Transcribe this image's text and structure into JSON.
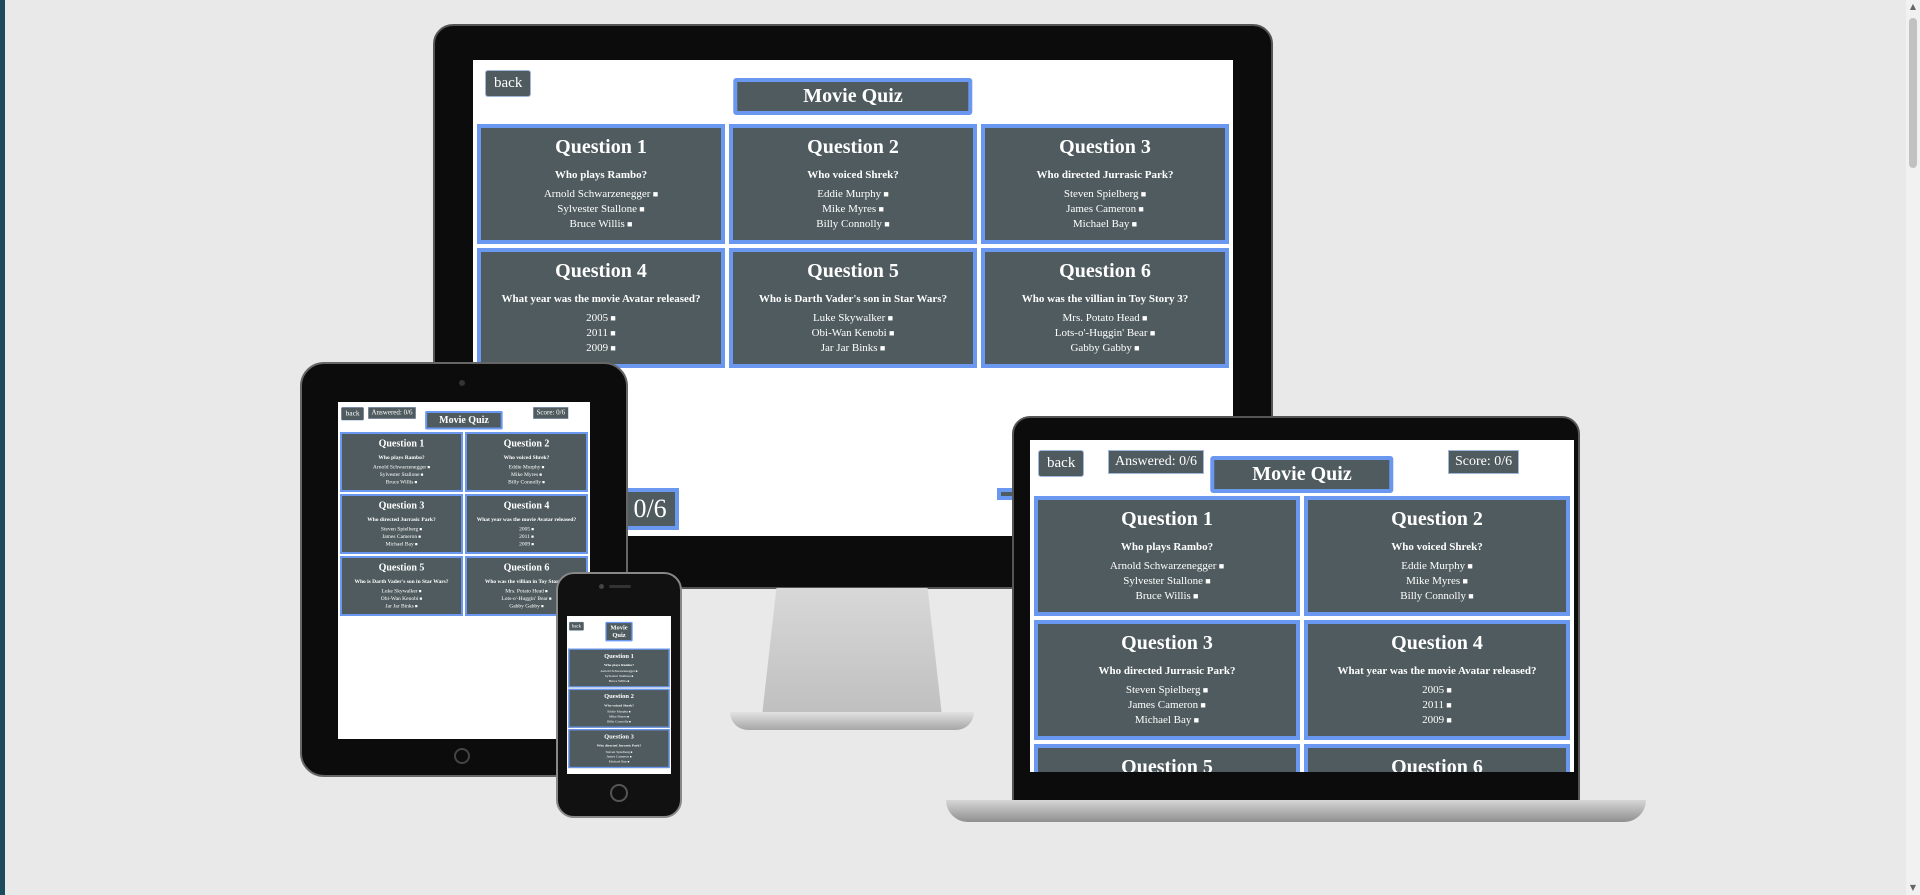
{
  "app": {
    "back": "back",
    "title": "Movie Quiz",
    "answered": "Answered: 0/6",
    "answered_partial": "ered: 0/6",
    "score": "Score: 0/6",
    "score_compact": "Score: 0/6"
  },
  "questions": [
    {
      "title": "Question 1",
      "question": "Who plays Rambo?",
      "options": [
        "Arnold Schwarzenegger",
        "Sylvester Stallone",
        "Bruce Willis"
      ]
    },
    {
      "title": "Question 2",
      "question": "Who voiced Shrek?",
      "options": [
        "Eddie Murphy",
        "Mike Myres",
        "Billy Connolly"
      ]
    },
    {
      "title": "Question 3",
      "question": "Who directed Jurrasic Park?",
      "options": [
        "Steven Spielberg",
        "James Cameron",
        "Michael Bay"
      ]
    },
    {
      "title": "Question 4",
      "question": "What year was the movie Avatar released?",
      "options": [
        "2005",
        "2011",
        "2009"
      ]
    },
    {
      "title": "Question 5",
      "question": "Who is Darth Vader's son in Star Wars?",
      "options": [
        "Luke Skywalker",
        "Obi-Wan Kenobi",
        "Jar Jar Binks"
      ]
    },
    {
      "title": "Question 6",
      "question": "Who was the villian in Toy Story 3?",
      "options": [
        "Mrs. Potato Head",
        "Lots-o'-Huggin' Bear",
        "Gabby Gabby"
      ]
    }
  ],
  "colors": {
    "card": "#4f5b5e",
    "border": "#6a97ef",
    "background": "#e9e9e9"
  }
}
